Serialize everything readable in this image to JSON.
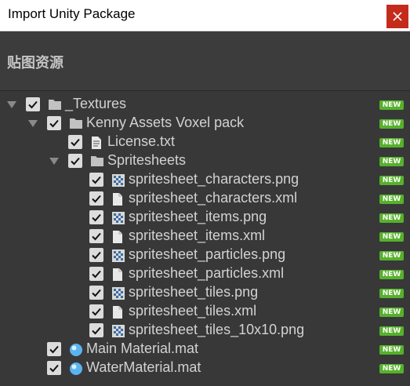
{
  "window": {
    "title": "Import Unity Package"
  },
  "header": {
    "title": "贴图资源"
  },
  "badge_text": "NEW",
  "colors": {
    "badge": "#56b12b",
    "close": "#c42b1c",
    "background": "#383838"
  },
  "tree": [
    {
      "label": "_Textures",
      "icon": "folder-icon",
      "depth": 0,
      "expandable": true,
      "checked": true
    },
    {
      "label": "Kenny Assets Voxel pack",
      "icon": "folder-icon",
      "depth": 1,
      "expandable": true,
      "checked": true
    },
    {
      "label": "License.txt",
      "icon": "text-file-icon",
      "depth": 2,
      "expandable": false,
      "checked": true
    },
    {
      "label": "Spritesheets",
      "icon": "folder-icon",
      "depth": 2,
      "expandable": true,
      "checked": true
    },
    {
      "label": "spritesheet_characters.png",
      "icon": "image-file-icon",
      "depth": 3,
      "expandable": false,
      "checked": true
    },
    {
      "label": "spritesheet_characters.xml",
      "icon": "file-icon",
      "depth": 3,
      "expandable": false,
      "checked": true
    },
    {
      "label": "spritesheet_items.png",
      "icon": "image-file-icon",
      "depth": 3,
      "expandable": false,
      "checked": true
    },
    {
      "label": "spritesheet_items.xml",
      "icon": "file-icon",
      "depth": 3,
      "expandable": false,
      "checked": true
    },
    {
      "label": "spritesheet_particles.png",
      "icon": "image-file-icon",
      "depth": 3,
      "expandable": false,
      "checked": true
    },
    {
      "label": "spritesheet_particles.xml",
      "icon": "file-icon",
      "depth": 3,
      "expandable": false,
      "checked": true
    },
    {
      "label": "spritesheet_tiles.png",
      "icon": "image-file-icon",
      "depth": 3,
      "expandable": false,
      "checked": true
    },
    {
      "label": "spritesheet_tiles.xml",
      "icon": "file-icon",
      "depth": 3,
      "expandable": false,
      "checked": true
    },
    {
      "label": "spritesheet_tiles_10x10.png",
      "icon": "image-file-icon",
      "depth": 3,
      "expandable": false,
      "checked": true
    },
    {
      "label": "Main Material.mat",
      "icon": "material-icon",
      "depth": 1,
      "expandable": false,
      "checked": true
    },
    {
      "label": "WaterMaterial.mat",
      "icon": "material-icon",
      "depth": 1,
      "expandable": false,
      "checked": true
    }
  ]
}
